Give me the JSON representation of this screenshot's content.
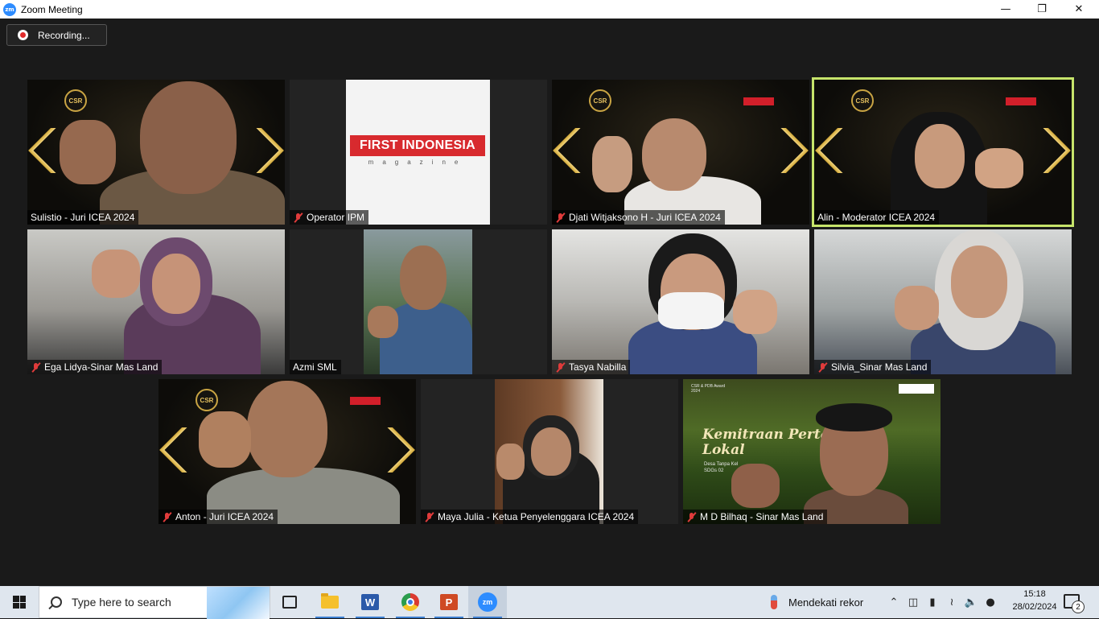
{
  "window": {
    "title": "Zoom Meeting",
    "app_icon": "zm",
    "controls": {
      "minimize_icon": "minimize-icon",
      "restore_icon": "restore-icon",
      "close_icon": "close-icon"
    }
  },
  "recording": {
    "label": "Recording..."
  },
  "accent_colors": {
    "active_speaker": "#c6e46b",
    "muted": "#e03b3b",
    "zoom_blue": "#2d8cff"
  },
  "participants": [
    {
      "name": "Sulistio - Juri ICEA 2024",
      "muted": false
    },
    {
      "name": "Operator IPM",
      "muted": true
    },
    {
      "name": "Djati Witjaksono H - Juri ICEA 2024",
      "muted": true
    },
    {
      "name": "Alin - Moderator ICEA 2024",
      "muted": false,
      "active": true
    },
    {
      "name": "Ega Lidya-Sinar Mas Land",
      "muted": true
    },
    {
      "name": "Azmi SML",
      "muted": false
    },
    {
      "name": "Tasya Nabilla",
      "muted": true
    },
    {
      "name": "Silvia_Sinar Mas Land",
      "muted": true
    },
    {
      "name": "Anton - Juri ICEA 2024",
      "muted": true
    },
    {
      "name": "Maya Julia - Ketua Penyelenggara ICEA 2024",
      "muted": true
    },
    {
      "name": "M D Bilhaq - Sinar Mas Land",
      "muted": true
    }
  ],
  "backgrounds": {
    "csr_badge": "CSR",
    "first_indonesia": {
      "title": "FIRST INDONESIA",
      "subtitle": "magazine"
    },
    "farm": {
      "title_line1": "Kemitraan Pertan",
      "title_line2": "Lokal",
      "sub_line1": "Desa Tanpa Kel",
      "sub_line2": "SDGs 02",
      "small_line1": "CSR & PDB Award",
      "small_line2": "2024"
    }
  },
  "taskbar": {
    "search_placeholder": "Type here to search",
    "word_letter": "W",
    "ppt_letter": "P",
    "zoom_letter": "zm",
    "weather": "Mendekati rekor",
    "time": "15:18",
    "date": "28/02/2024",
    "notification_count": "2"
  }
}
